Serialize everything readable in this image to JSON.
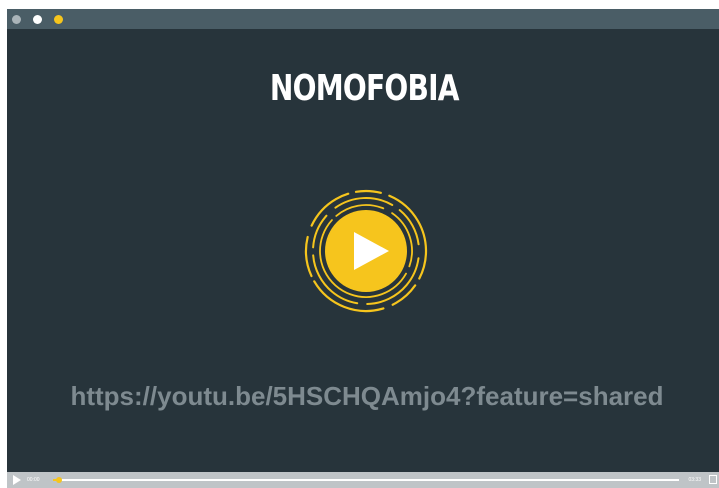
{
  "window": {
    "controls": [
      "close-dot",
      "minimize-dot",
      "maximize-dot"
    ]
  },
  "video": {
    "title": "NOMOFOBIA",
    "link": "https://youtu.be/5HSCHQAmjo4?feature=shared",
    "play_icon": "play-icon"
  },
  "player": {
    "current_time": "00:00",
    "duration": "03:33",
    "progress": 0.01
  },
  "colors": {
    "accent": "#f6c51d",
    "background": "#27343b",
    "titlebar": "#4a5d66",
    "link": "#7e8a90",
    "controlbar": "#bfc4c7"
  }
}
